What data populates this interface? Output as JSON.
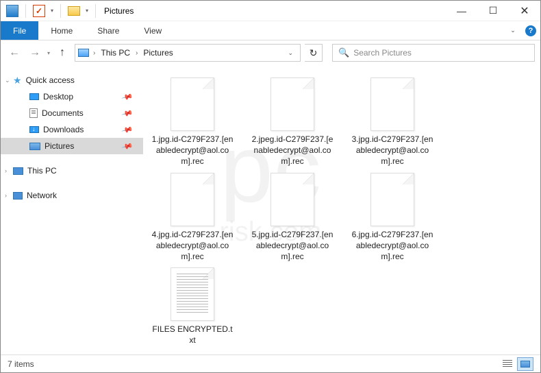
{
  "window": {
    "title": "Pictures"
  },
  "ribbon": {
    "file": "File",
    "tabs": [
      "Home",
      "Share",
      "View"
    ]
  },
  "breadcrumb": {
    "root": "This PC",
    "current": "Pictures"
  },
  "search": {
    "placeholder": "Search Pictures"
  },
  "sidebar": {
    "quick_access": "Quick access",
    "items": [
      {
        "label": "Desktop",
        "pinned": true,
        "icon": "desktop"
      },
      {
        "label": "Documents",
        "pinned": true,
        "icon": "doc"
      },
      {
        "label": "Downloads",
        "pinned": true,
        "icon": "down"
      },
      {
        "label": "Pictures",
        "pinned": true,
        "icon": "pic",
        "selected": true
      }
    ],
    "this_pc": "This PC",
    "network": "Network"
  },
  "files": [
    {
      "name": "1.jpg.id-C279F237.[enabledecrypt@aol.com].rec",
      "type": "file"
    },
    {
      "name": "2.jpeg.id-C279F237.[enabledecrypt@aol.com].rec",
      "type": "file"
    },
    {
      "name": "3.jpg.id-C279F237.[enabledecrypt@aol.com].rec",
      "type": "file"
    },
    {
      "name": "4.jpg.id-C279F237.[enabledecrypt@aol.com].rec",
      "type": "file"
    },
    {
      "name": "5.jpg.id-C279F237.[enabledecrypt@aol.com].rec",
      "type": "file"
    },
    {
      "name": "6.jpg.id-C279F237.[enabledecrypt@aol.com].rec",
      "type": "file"
    },
    {
      "name": "FILES ENCRYPTED.txt",
      "type": "txt"
    }
  ],
  "status": {
    "count": "7 items"
  },
  "watermark": {
    "big": "pc",
    "sub": "risk.com"
  }
}
